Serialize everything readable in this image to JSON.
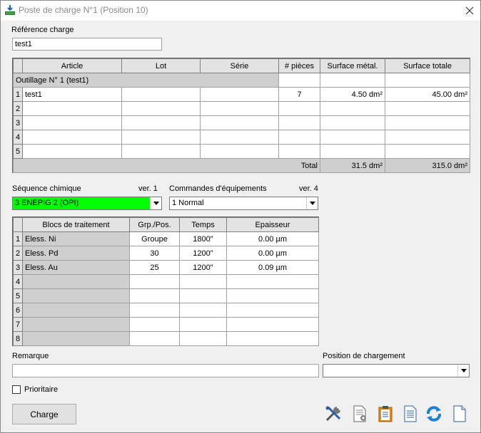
{
  "window": {
    "title": "Poste de charge N°1 (Position 10)"
  },
  "reference": {
    "label": "Référence charge",
    "value": "test1"
  },
  "articles": {
    "columns": [
      "Article",
      "Lot",
      "Série",
      "# pièces",
      "Surface métal.",
      "Surface totale"
    ],
    "group_label": "Outillage N° 1  (test1)",
    "rows": [
      {
        "num": "1",
        "article": "test1",
        "lot": "",
        "serie": "",
        "pieces": "7",
        "surface_metal": "4.50 dm²",
        "surface_totale": "45.00 dm²"
      },
      {
        "num": "2",
        "article": "",
        "lot": "",
        "serie": "",
        "pieces": "",
        "surface_metal": "",
        "surface_totale": ""
      },
      {
        "num": "3",
        "article": "",
        "lot": "",
        "serie": "",
        "pieces": "",
        "surface_metal": "",
        "surface_totale": ""
      },
      {
        "num": "4",
        "article": "",
        "lot": "",
        "serie": "",
        "pieces": "",
        "surface_metal": "",
        "surface_totale": ""
      },
      {
        "num": "5",
        "article": "",
        "lot": "",
        "serie": "",
        "pieces": "",
        "surface_metal": "",
        "surface_totale": ""
      }
    ],
    "total_label": "Total",
    "total_metal": "31.5 dm²",
    "total_totale": "315.0 dm²"
  },
  "sequence": {
    "label": "Séquence chimique",
    "version": "ver. 1",
    "value": "3 ENEPIG 2 (OPI)",
    "color": "#00ff00"
  },
  "commandes": {
    "label": "Commandes d'équipements",
    "version": "ver. 4",
    "value": "1 Normal"
  },
  "blocs": {
    "columns": [
      "Blocs de traitement",
      "Grp./Pos.",
      "Temps",
      "Epaisseur"
    ],
    "rows": [
      {
        "num": "1",
        "bloc": "Eless. Ni",
        "grp": "Groupe",
        "temps": "1800\"",
        "epaisseur": "0.00 µm"
      },
      {
        "num": "2",
        "bloc": "Eless. Pd",
        "grp": "30",
        "temps": "1200\"",
        "epaisseur": "0.00 µm"
      },
      {
        "num": "3",
        "bloc": "Eless. Au",
        "grp": "25",
        "temps": "1200\"",
        "epaisseur": "0.09 µm"
      },
      {
        "num": "4",
        "bloc": "",
        "grp": "",
        "temps": "",
        "epaisseur": ""
      },
      {
        "num": "5",
        "bloc": "",
        "grp": "",
        "temps": "",
        "epaisseur": ""
      },
      {
        "num": "6",
        "bloc": "",
        "grp": "",
        "temps": "",
        "epaisseur": ""
      },
      {
        "num": "7",
        "bloc": "",
        "grp": "",
        "temps": "",
        "epaisseur": ""
      },
      {
        "num": "8",
        "bloc": "",
        "grp": "",
        "temps": "",
        "epaisseur": ""
      }
    ]
  },
  "remarque": {
    "label": "Remarque",
    "value": ""
  },
  "position": {
    "label": "Position de chargement",
    "value": ""
  },
  "prioritaire": {
    "label": "Prioritaire",
    "checked": false
  },
  "charge_button": {
    "label": "Charge"
  }
}
